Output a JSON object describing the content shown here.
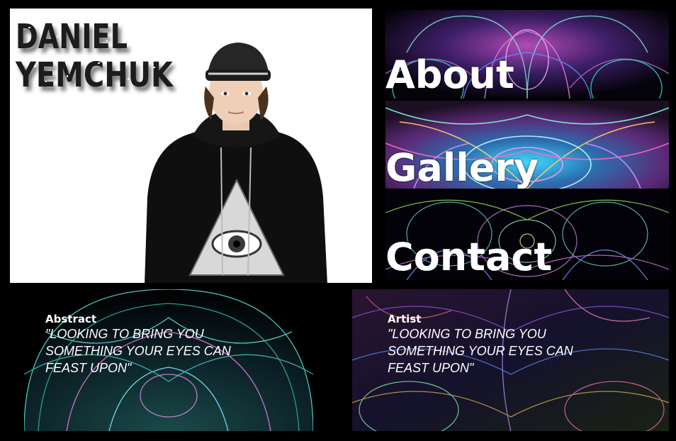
{
  "brand": {
    "line1": "DANIEL",
    "line2": "YEMCHUK"
  },
  "hero": {
    "image": "portrait-photo"
  },
  "nav": {
    "about": "About",
    "gallery": "Gallery",
    "contact": "Contact"
  },
  "cards": {
    "abstract": {
      "title": "Abstract",
      "quote": "\"LOOKING TO BRING YOU SOMETHING YOUR EYES CAN FEAST UPON\""
    },
    "artist": {
      "title": "Artist",
      "quote": "\"LOOKING TO BRING YOU SOMETHING YOUR EYES CAN FEAST UPON\""
    }
  },
  "colors": {
    "background": "#000000",
    "text": "#ffffff",
    "fractal_teal": "#2ec4b6",
    "fractal_magenta": "#c23fb4",
    "fractal_purple": "#6a3fd1"
  }
}
